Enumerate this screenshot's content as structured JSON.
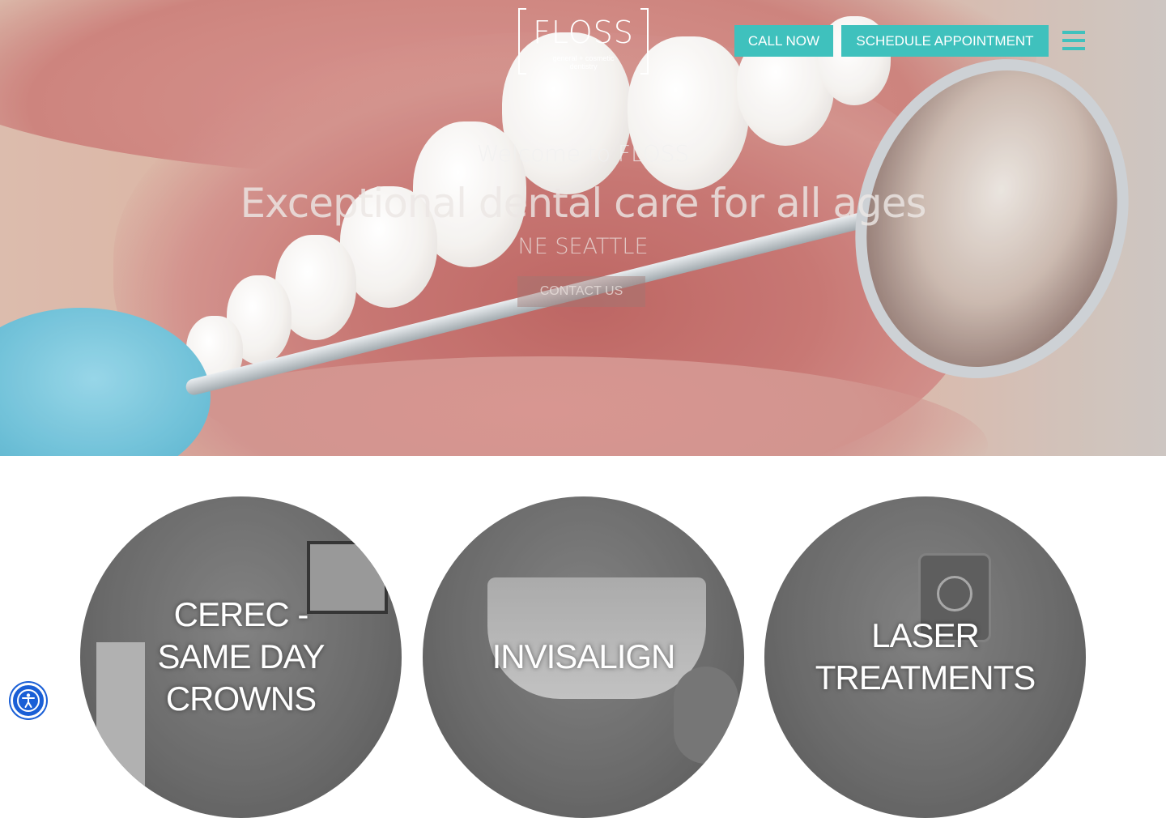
{
  "header": {
    "logo_name": "FLOSS",
    "logo_sub_1": "general + cosmetic",
    "logo_sub_2": "dentistry",
    "call_label": "CALL NOW",
    "schedule_label": "SCHEDULE APPOINTMENT",
    "menu_icon": "hamburger-icon"
  },
  "hero": {
    "welcome": "Welcome to FLOSS",
    "headline": "Exceptional dental care for all ages",
    "location": "NE SEATTLE",
    "contact_label": "CONTACT US"
  },
  "services": [
    {
      "label_lines": [
        "CEREC -",
        "SAME DAY",
        "CROWNS"
      ]
    },
    {
      "label_lines": [
        "INVISALIGN"
      ]
    },
    {
      "label_lines": [
        "LASER",
        "TREATMENTS"
      ]
    }
  ],
  "accessibility": {
    "icon": "accessibility-icon"
  },
  "colors": {
    "accent": "#3fc1bd",
    "accessibility": "#1a5fd6"
  }
}
